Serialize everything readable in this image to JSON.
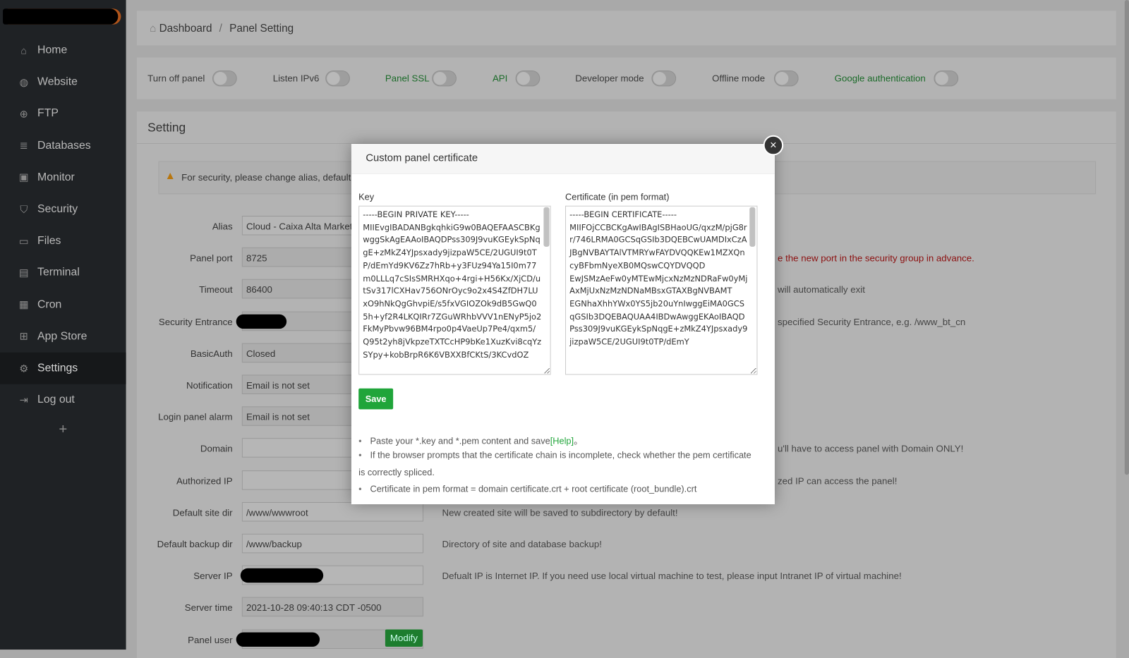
{
  "sidebar": {
    "items": [
      {
        "label": "Home",
        "icon": "home-icon",
        "glyph": "⌂"
      },
      {
        "label": "Website",
        "icon": "globe-icon",
        "glyph": "◍"
      },
      {
        "label": "FTP",
        "icon": "ftp-icon",
        "glyph": "⊕"
      },
      {
        "label": "Databases",
        "icon": "database-icon",
        "glyph": "≣"
      },
      {
        "label": "Monitor",
        "icon": "monitor-icon",
        "glyph": "▣"
      },
      {
        "label": "Security",
        "icon": "shield-icon",
        "glyph": "⛉"
      },
      {
        "label": "Files",
        "icon": "folder-icon",
        "glyph": "▭"
      },
      {
        "label": "Terminal",
        "icon": "terminal-icon",
        "glyph": "▤"
      },
      {
        "label": "Cron",
        "icon": "calendar-icon",
        "glyph": "▦"
      },
      {
        "label": "App Store",
        "icon": "apps-icon",
        "glyph": "⊞"
      },
      {
        "label": "Settings",
        "icon": "gear-icon",
        "glyph": "⚙"
      },
      {
        "label": "Log out",
        "icon": "logout-icon",
        "glyph": "⇥"
      }
    ],
    "add": "+"
  },
  "breadcrumb": {
    "home": "Dashboard",
    "sep": "/",
    "current": "Panel Setting"
  },
  "toggles": [
    {
      "label": "Turn off panel",
      "green": false
    },
    {
      "label": "Listen IPv6",
      "green": false
    },
    {
      "label": "Panel SSL",
      "green": true
    },
    {
      "label": "API",
      "green": true
    },
    {
      "label": "Developer mode",
      "green": false
    },
    {
      "label": "Offline mode",
      "green": false
    },
    {
      "label": "Google authentication",
      "green": true
    }
  ],
  "setting": {
    "title": "Setting",
    "warning": "For security, please change alias, default p",
    "fields": [
      {
        "label": "Alias",
        "value": "Cloud - Caixa Alta Marketi"
      },
      {
        "label": "Panel port",
        "value": "8725",
        "help": "e the new port in the security group in advance."
      },
      {
        "label": "Timeout",
        "value": "86400",
        "help": "will automatically exit"
      },
      {
        "label": "Security Entrance",
        "value": "",
        "help": "specified Security Entrance, e.g. /www_bt_cn"
      },
      {
        "label": "BasicAuth",
        "value": "Closed"
      },
      {
        "label": "Notification",
        "value": "Email is not set"
      },
      {
        "label": "Login panel alarm",
        "value": "Email is not set"
      },
      {
        "label": "Domain",
        "value": "",
        "help": "u'll have to access panel with Domain ONLY!"
      },
      {
        "label": "Authorized IP",
        "value": "",
        "help": "zed IP can access the panel!"
      },
      {
        "label": "Default site dir",
        "value": "/www/wwwroot",
        "help": "New created site will be saved to subdirectory by default!"
      },
      {
        "label": "Default backup dir",
        "value": "/www/backup",
        "help": "Directory of site and database backup!"
      },
      {
        "label": "Server IP",
        "value": "",
        "help": "Defualt IP is Internet IP. If you need use local virtual machine to test, please input Intranet IP of virtual machine!"
      },
      {
        "label": "Server time",
        "value": "2021-10-28 09:40:13 CDT -0500"
      },
      {
        "label": "Panel user",
        "value": ""
      }
    ],
    "modify": "Modify"
  },
  "modal": {
    "title": "Custom panel certificate",
    "close": "×",
    "key_label": "Key",
    "cert_label": "Certificate (in pem format)",
    "key": "-----BEGIN PRIVATE KEY-----\nMIIEvgIBADANBgkqhkiG9w0BAQEFAASCBKgwggSkAgEAAoIBAQDPss309J9vuKGEykSpNqgE+zMkZ4YJpsxady9jizpaW5CE/2UGUI9t0TP/dEmYd9KV6Zz7hRb+y3FUz94Ya15I0m77m0LLLq7cSIsSMRHXqo+4rgi+H56Kx/XjCD/utSv317lCXHav756ONrOyc9o2x4S4ZfDH7LUxO9hNkQgGhvpiE/s5fxVGIOZOk9dB5GwQ05h+yf2R4LKQIRr7ZGuWRhbVVV1nENyP5jo2FkMyPbvw96BM4rpo0p4VaeUp7Pe4/qxm5/Q95t2yh8jVkpzeTXTCcHP9bKe1XuzKvi8cqYzSYpy+kobBrpR6K6VBXXBfCKtS/3KCvdOZ",
    "cert": "-----BEGIN CERTIFICATE-----\nMIIFOjCCBCKgAwIBAgISBHaoUG/qxzM/pjG8rr/746LRMA0GCSqGSIb3DQEBCwUAMDIxCzAJBgNVBAYTAlVTMRYwFAYDVQQKEw1MZXQncyBFbmNyeXB0MQswCQYDVQQD\nEwJSMzAeFw0yMTEwMjcxNzMzNDRaFw0yMjAxMjUxNzMzNDNaMBsxGTAXBgNVBAMT\nEGNhaXhhYWx0YS5jb20uYnIwggEiMA0GCSqGSIb3DQEBAQUAA4IBDwAwggEKAoIBAQDPss309J9vuKGEykSpNqgE+zMkZ4YJpsxady9jizpaW5CE/2UGUI9t0TP/dEmY",
    "save": "Save",
    "notes": {
      "n1": "Paste your *.key and *.pem content and save",
      "help": "[Help]",
      "n1end": "。",
      "n2": "If the browser prompts that the certificate chain is incomplete, check whether the pem certificate",
      "n2b": "is correctly spliced.",
      "n3": "Certificate in pem format = domain certificate.crt + root certificate (root_bundle).crt"
    }
  },
  "colors": {
    "accent": "#20a53a",
    "sidebar": "#1f2225"
  }
}
